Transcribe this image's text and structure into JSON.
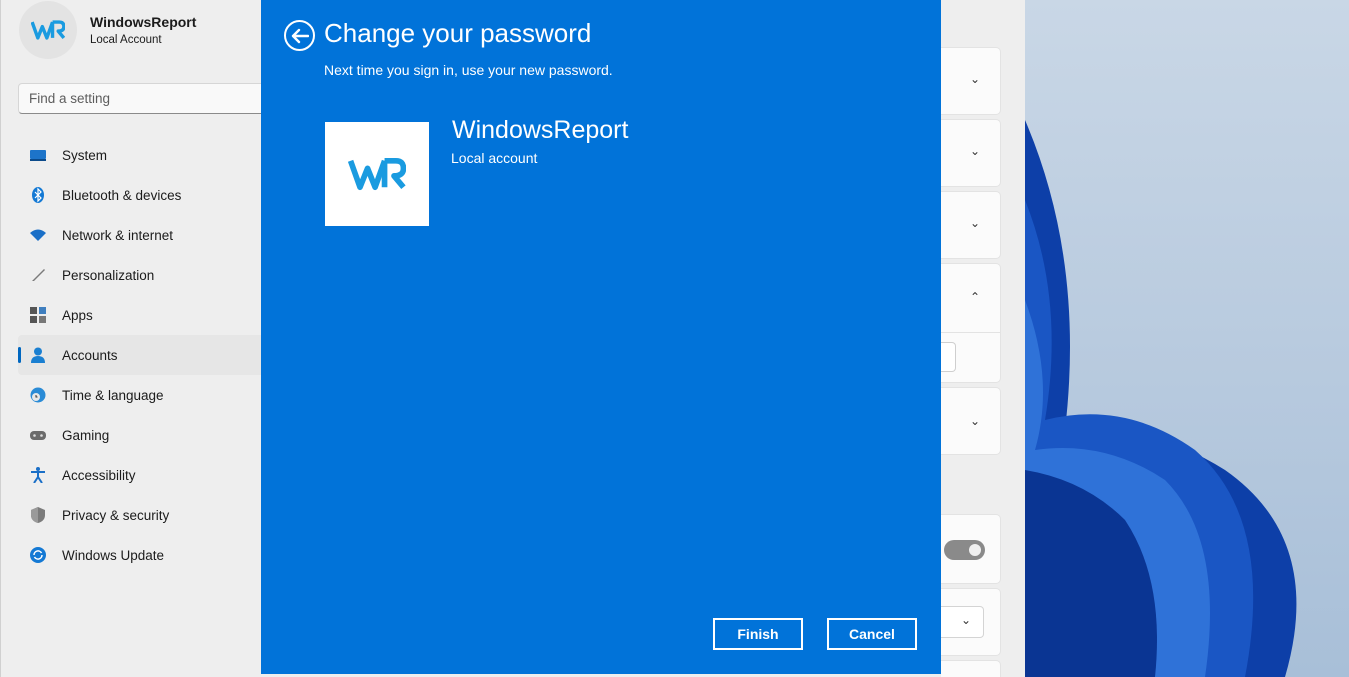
{
  "profile": {
    "name": "WindowsReport",
    "subtitle": "Local Account"
  },
  "search": {
    "placeholder": "Find a setting"
  },
  "sidebar": {
    "items": [
      {
        "label": "System",
        "icon": "monitor-icon",
        "active": false
      },
      {
        "label": "Bluetooth & devices",
        "icon": "bluetooth-icon",
        "active": false
      },
      {
        "label": "Network & internet",
        "icon": "wifi-icon",
        "active": false
      },
      {
        "label": "Personalization",
        "icon": "brush-icon",
        "active": false
      },
      {
        "label": "Apps",
        "icon": "apps-icon",
        "active": false
      },
      {
        "label": "Accounts",
        "icon": "person-icon",
        "active": true
      },
      {
        "label": "Time & language",
        "icon": "clock-globe-icon",
        "active": false
      },
      {
        "label": "Gaming",
        "icon": "gamepad-icon",
        "active": false
      },
      {
        "label": "Accessibility",
        "icon": "accessibility-icon",
        "active": false
      },
      {
        "label": "Privacy & security",
        "icon": "shield-icon",
        "active": false
      },
      {
        "label": "Windows Update",
        "icon": "update-icon",
        "active": false
      }
    ]
  },
  "dialog": {
    "title": "Change your password",
    "subtitle": "Next time you sign in, use your new password.",
    "account_name": "WindowsReport",
    "account_type": "Local account",
    "finish_label": "Finish",
    "cancel_label": "Cancel",
    "background_color": "#0173d9"
  },
  "colors": {
    "accent": "#0067c0",
    "logo_blue": "#1a9be0"
  }
}
